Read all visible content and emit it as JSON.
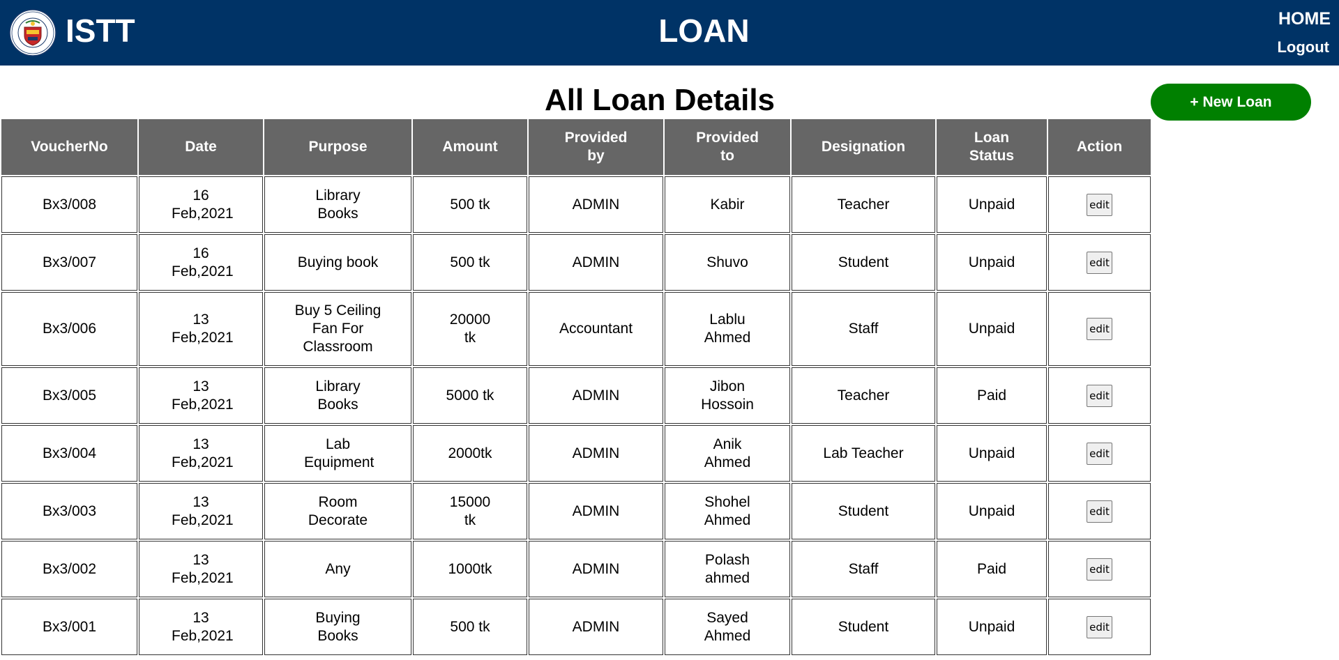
{
  "header": {
    "brand": "ISTT",
    "title": "LOAN",
    "nav": {
      "home": "HOME",
      "logout": "Logout"
    },
    "color": "#003366"
  },
  "main": {
    "section_title": "All Loan Details",
    "new_loan_label": "+ New Loan",
    "new_loan_color": "#008000"
  },
  "table": {
    "header_color": "#666666",
    "columns": [
      "VoucherNo",
      "Date",
      "Purpose",
      "Amount",
      "Provided by",
      "Provided to",
      "Designation",
      "Loan Status",
      "Action"
    ],
    "rows": [
      {
        "voucher": "Bx3/008",
        "date": "16 Feb,2021",
        "purpose": "Library Books",
        "amount": "500 tk",
        "provided_by": "ADMIN",
        "provided_to": "Kabir",
        "designation": "Teacher",
        "status": "Unpaid",
        "action": "edit"
      },
      {
        "voucher": "Bx3/007",
        "date": "16 Feb,2021",
        "purpose": "Buying book",
        "amount": "500 tk",
        "provided_by": "ADMIN",
        "provided_to": "Shuvo",
        "designation": "Student",
        "status": "Unpaid",
        "action": "edit"
      },
      {
        "voucher": "Bx3/006",
        "date": "13 Feb,2021",
        "purpose": "Buy 5 Ceiling Fan For Classroom",
        "amount": "20000 tk",
        "provided_by": "Accountant",
        "provided_to": "Lablu Ahmed",
        "designation": "Staff",
        "status": "Unpaid",
        "action": "edit"
      },
      {
        "voucher": "Bx3/005",
        "date": "13 Feb,2021",
        "purpose": "Library Books",
        "amount": "5000 tk",
        "provided_by": "ADMIN",
        "provided_to": "Jibon Hossoin",
        "designation": "Teacher",
        "status": "Paid",
        "action": "edit"
      },
      {
        "voucher": "Bx3/004",
        "date": "13 Feb,2021",
        "purpose": "Lab Equipment",
        "amount": "2000tk",
        "provided_by": "ADMIN",
        "provided_to": "Anik Ahmed",
        "designation": "Lab Teacher",
        "status": "Unpaid",
        "action": "edit"
      },
      {
        "voucher": "Bx3/003",
        "date": "13 Feb,2021",
        "purpose": "Room Decorate",
        "amount": "15000 tk",
        "provided_by": "ADMIN",
        "provided_to": "Shohel Ahmed",
        "designation": "Student",
        "status": "Unpaid",
        "action": "edit"
      },
      {
        "voucher": "Bx3/002",
        "date": "13 Feb,2021",
        "purpose": "Any",
        "amount": "1000tk",
        "provided_by": "ADMIN",
        "provided_to": "Polash ahmed",
        "designation": "Staff",
        "status": "Paid",
        "action": "edit"
      },
      {
        "voucher": "Bx3/001",
        "date": "13 Feb,2021",
        "purpose": "Buying Books",
        "amount": "500 tk",
        "provided_by": "ADMIN",
        "provided_to": "Sayed Ahmed",
        "designation": "Student",
        "status": "Unpaid",
        "action": "edit"
      }
    ]
  }
}
